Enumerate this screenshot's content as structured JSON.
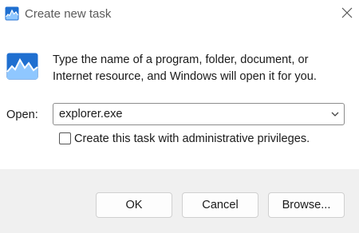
{
  "window": {
    "title": "Create new task"
  },
  "dialog": {
    "description": "Type the name of a program, folder, document, or Internet resource, and Windows will open it for you.",
    "open_label": "Open:",
    "open_value": "explorer.exe",
    "admin_checkbox_label": "Create this task with administrative privileges.",
    "admin_checked": false
  },
  "buttons": {
    "ok": "OK",
    "cancel": "Cancel",
    "browse": "Browse..."
  },
  "icons": {
    "title": "task-manager-icon",
    "close": "close-icon",
    "app": "task-manager-icon",
    "dropdown": "chevron-down-icon"
  },
  "colors": {
    "icon_blue": "#1f6fd0",
    "icon_light": "#8fc7ff",
    "footer_bg": "#f0f0f0"
  }
}
